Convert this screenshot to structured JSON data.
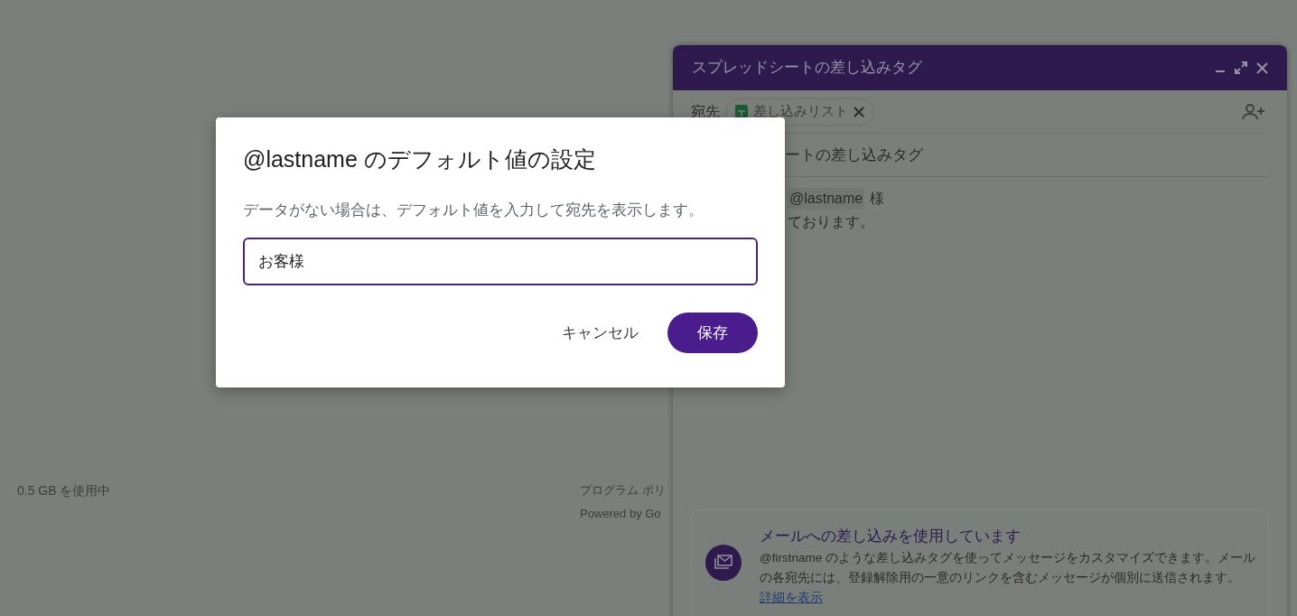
{
  "page_footer": {
    "storage": "0.5 GB を使用中",
    "links": [
      "プログラム ポリ",
      "Powered by Go"
    ]
  },
  "compose": {
    "title": "スプレッドシートの差し込みタグ",
    "to_label": "宛先",
    "recipient_chip": "差し込みリスト",
    "subject": "ートの差し込みタグ",
    "body_tag": "@lastname",
    "body_suffix": "様",
    "body_line_2": "ております。",
    "info_card": {
      "title": "メールへの差し込みを使用しています",
      "text": "@firstname のような差し込みタグを使ってメッセージをカスタマイズできます。メールの各宛先には、登録解除用の一意のリンクを含むメッセージが個別に送信されます。",
      "link": "詳細を表示"
    }
  },
  "dialog": {
    "title": "@lastname のデフォルト値の設定",
    "description": "データがない場合は、デフォルト値を入力して宛先を表示します。",
    "input_value": "お客様",
    "buttons": [
      {
        "label": "キャンセル",
        "kind": "text"
      },
      {
        "label": "保存",
        "kind": "primary"
      }
    ]
  }
}
